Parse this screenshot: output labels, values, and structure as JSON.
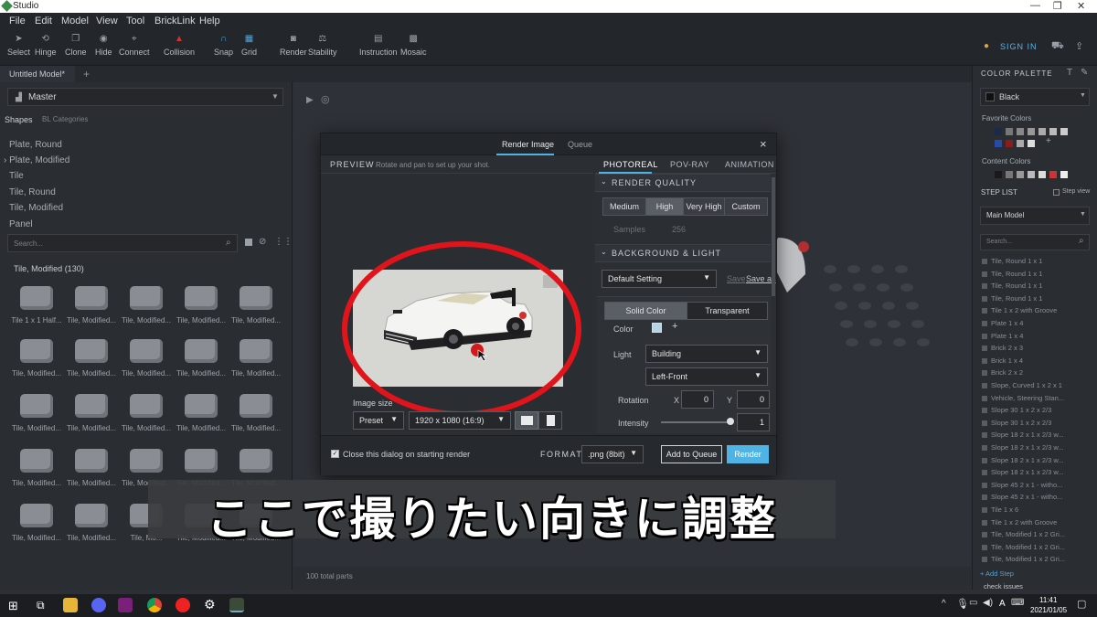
{
  "window": {
    "title": "Studio"
  },
  "menu": [
    "File",
    "Edit",
    "Model",
    "View",
    "Tool",
    "BrickLink",
    "Help"
  ],
  "toolbar": {
    "tools": [
      "Select",
      "Hinge",
      "Clone",
      "Hide",
      "Connect",
      "Collision",
      "Snap",
      "Grid",
      "Render",
      "Stability",
      "Instruction",
      "Mosaic"
    ],
    "sign_in": "SIGN IN"
  },
  "tabs": {
    "model_tab": "Untitled Model*",
    "add": "+"
  },
  "left": {
    "master": "Master",
    "shapes_tab": "Shapes",
    "bl_categories": "BL Categories",
    "categories": [
      "Plate, Round",
      "Plate, Modified",
      "Tile",
      "Tile, Round",
      "Tile, Modified",
      "Panel"
    ],
    "search_placeholder": "Search...",
    "group_title": "Tile, Modified (130)",
    "parts": [
      "Tile 1 x 1 Half...",
      "Tile, Modified...",
      "Tile, Modified...",
      "Tile, Modified...",
      "Tile, Modified...",
      "Tile, Modified...",
      "Tile, Modified...",
      "Tile, Modified...",
      "Tile, Modified...",
      "Tile, Modified...",
      "Tile, Modified...",
      "Tile, Modified...",
      "Tile, Modified...",
      "Tile, Modified...",
      "Tile, Modified...",
      "Tile, Modified...",
      "Tile, Modified...",
      "Tile, Modified...",
      "Tile, Modified...",
      "Tile, Modified...",
      "Tile, Modified...",
      "Tile, Modified...",
      "Tile, Mo...",
      "Tile, Modified...",
      "Tile, Modified..."
    ]
  },
  "status": {
    "total_parts": "100 total parts"
  },
  "right": {
    "color_palette": "COLOR PALETTE",
    "selected_color": "Black",
    "favorite_colors": "Favorite Colors",
    "content_colors": "Content Colors",
    "step_list": "STEP LIST",
    "step_view": "Step view",
    "main_model": "Main Model",
    "search_placeholder": "Search...",
    "steps": [
      "Tile, Round 1 x 1",
      "Tile, Round 1 x 1",
      "Tile, Round 1 x 1",
      "Tile, Round 1 x 1",
      "Tile 1 x 2 with Groove",
      "Plate 1 x 4",
      "Plate 1 x 4",
      "Brick 2 x 3",
      "Brick 1 x 4",
      "Brick 2 x 2",
      "Slope, Curved 1 x 2 x 1",
      "Vehicle, Steering Stan...",
      "Slope 30 1 x 2 x 2/3",
      "Slope 30 1 x 2 x 2/3",
      "Slope 18 2 x 1 x 2/3 w...",
      "Slope 18 2 x 1 x 2/3 w...",
      "Slope 18 2 x 1 x 2/3 w...",
      "Slope 18 2 x 1 x 2/3 w...",
      "Slope 45 2 x 1 - witho...",
      "Slope 45 2 x 1 - witho...",
      "Tile 1 x 6",
      "Tile 1 x 2 with Groove",
      "Tile, Modified 1 x 2 Gri...",
      "Tile, Modified 1 x 2 Gri...",
      "Tile, Modified 1 x 2 Gri..."
    ],
    "add_step": "+ Add Step",
    "check_issues": "check issues"
  },
  "dialog": {
    "tab_render": "Render Image",
    "tab_queue": "Queue",
    "close": "×",
    "preview_label": "PREVIEW",
    "preview_hint": "Rotate and pan to set up your shot.",
    "engines": [
      "PHOTOREAL",
      "POV-RAY",
      "ANIMATION"
    ],
    "render_quality_title": "RENDER QUALITY",
    "quality": [
      "Medium",
      "High",
      "Very High",
      "Custom"
    ],
    "samples_label": "Samples",
    "samples_value": "256",
    "bg_title": "BACKGROUND & LIGHT",
    "default_setting": "Default Setting",
    "save": "Save",
    "save_as": "Save as",
    "bg_modes": [
      "Solid Color",
      "Transparent"
    ],
    "color_label": "Color",
    "light_label": "Light",
    "light_value": "Building",
    "light_dir": "Left-Front",
    "rotation_label": "Rotation",
    "x_label": "X",
    "x_value": "0",
    "y_label": "Y",
    "y_value": "0",
    "intensity_label": "Intensity",
    "intensity_value": "1",
    "image_size_label": "Image size",
    "preset": "Preset",
    "resolution": "1920 x 1080 (16:9)",
    "close_checkbox_label": "Close this dialog on starting render",
    "format_label": "FORMAT",
    "format_value": ".png (8bit)",
    "add_to_queue": "Add to Queue",
    "render_button": "Render"
  },
  "subtitle": "ここで撮りたい向きに調整",
  "taskbar": {
    "time": "11:41",
    "date": "2021/01/05",
    "ime": "A"
  },
  "colors": {
    "accent": "#4fb3e6",
    "annotation_red": "#e0141a",
    "bg_dark": "#2c2f35"
  }
}
